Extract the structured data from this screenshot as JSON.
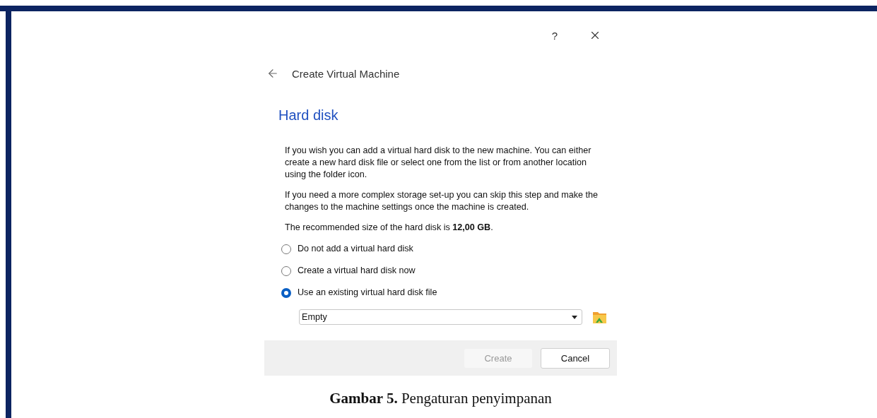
{
  "dialog": {
    "help": "?",
    "title": "Create Virtual Machine",
    "heading": "Hard disk",
    "paragraphs": [
      "If you wish you can add a virtual hard disk to the new machine. You can either create a new hard disk file or select one from the list or from another location using the folder icon.",
      "If you need a more complex storage set-up you can skip this step and make the changes to the machine settings once the machine is created.",
      "The recommended size of the hard disk is **12,00 GB**."
    ],
    "options": [
      {
        "label": "Do not add a virtual hard disk",
        "selected": false
      },
      {
        "label": "Create a virtual hard disk now",
        "selected": false
      },
      {
        "label": "Use an existing virtual hard disk file",
        "selected": true
      }
    ],
    "combo": {
      "value": "Empty"
    },
    "buttons": [
      {
        "label": "Create",
        "disabled": true
      },
      {
        "label": "Cancel",
        "disabled": false
      }
    ]
  },
  "caption": "**Gambar 5.** Pengaturan penyimpanan"
}
